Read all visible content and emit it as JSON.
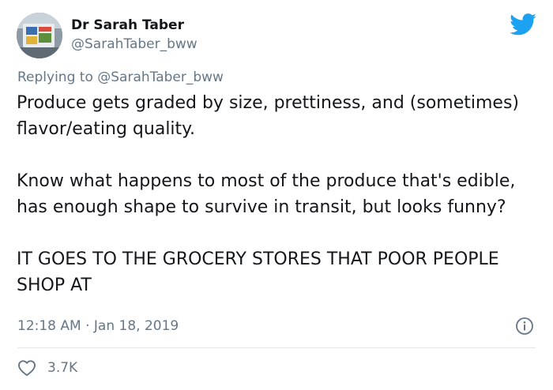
{
  "author": {
    "display_name": "Dr Sarah Taber",
    "handle": "@SarahTaber_bww"
  },
  "reply": {
    "prefix": "Replying to",
    "mention": "@SarahTaber_bww"
  },
  "tweet": {
    "paragraphs": [
      "Produce gets graded by size, prettiness, and (sometimes) flavor/eating quality.",
      "Know what happens to most of the produce that's edible, has enough shape to survive in transit, but looks funny?",
      "IT GOES TO THE GROCERY STORES THAT POOR PEOPLE SHOP AT"
    ],
    "timestamp": "12:18 AM · Jan 18, 2019"
  },
  "engagement": {
    "likes": "3.7K"
  },
  "icons": {
    "brand": "twitter-bird-icon",
    "info": "info-icon",
    "like": "heart-icon"
  },
  "colors": {
    "brand_blue": "#1da1f2",
    "secondary_text": "#657786",
    "primary_text": "#14171a",
    "divider": "#e1e8ed"
  }
}
